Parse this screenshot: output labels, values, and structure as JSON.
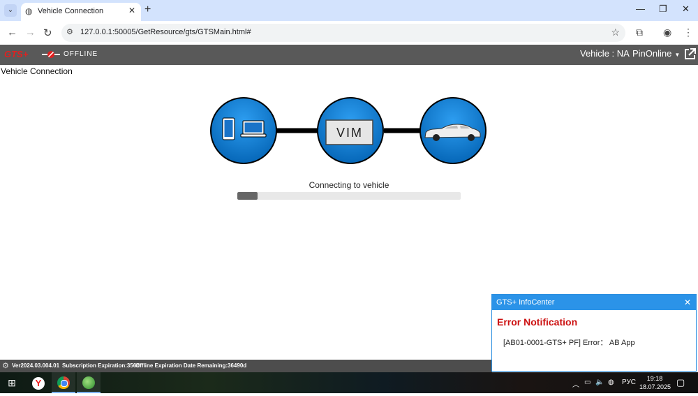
{
  "browser": {
    "tab_title": "Vehicle Connection",
    "url": "127.0.0.1:50005/GetResource/gts/GTSMain.html#"
  },
  "app": {
    "logo": "GTS+",
    "status": "OFFLINE",
    "vehicle": "Vehicle : NA",
    "pin_menu": "PinOnline"
  },
  "page": {
    "title": "Vehicle Connection",
    "vim_label": "VIM",
    "connecting_text": "Connecting to vehicle",
    "progress": 0.09
  },
  "footer": {
    "version": "Ver2024.03.004.01",
    "subscription": "Subscription Expiration:356d",
    "offline_expiration": "Offline Expiration Date Remaining:36490d"
  },
  "notification": {
    "header": "GTS+ InfoCenter",
    "title": "Error Notification",
    "message": "[AB01-0001-GTS+ PF] Error： AB App"
  },
  "taskbar": {
    "lang": "РУС",
    "time": "19:18",
    "date": "18.07.2025"
  },
  "colors": {
    "accent": "#2b93e8",
    "error": "#cc1111",
    "appbar": "#595959",
    "circle": "#0a73c4"
  }
}
